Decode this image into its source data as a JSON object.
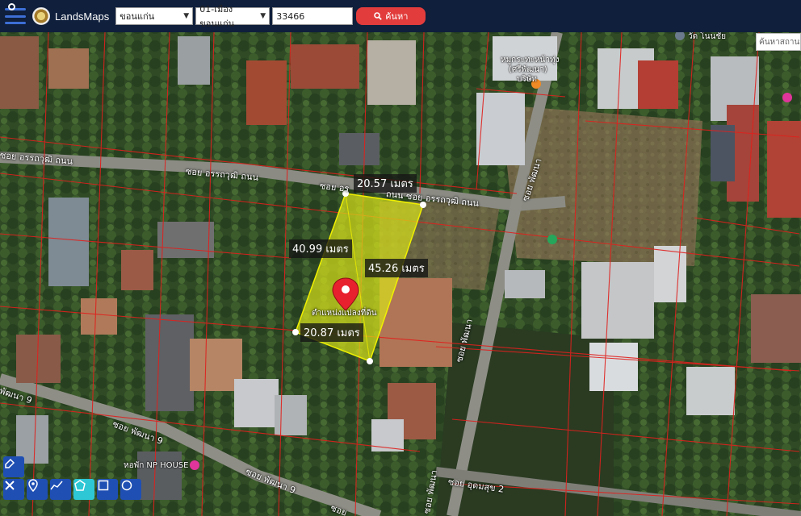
{
  "header": {
    "brand": "LandsMaps",
    "province_value": "ขอนแก่น",
    "district_value": "01-เมืองขอนแก่น",
    "parcel_number": "33466",
    "search_label": "ค้นหา"
  },
  "map": {
    "search_place_placeholder": "ค้นหาสถานที่",
    "measurements": {
      "top_edge": "20.57 เมตร",
      "left_edge": "40.99 เมตร",
      "right_edge": "45.26 เมตร",
      "bottom_edge": "20.87 เมตร"
    },
    "parcel_caption": "ตำแหน่งแปลงที่ดิน",
    "road_labels": [
      "ซอย อรรถวุฒิ ถนน",
      "ซอย อรรถวุฒิ ถนน",
      "ซอย อร",
      "ถนน ซอย อรรถวุฒิ ถนน",
      "ซอย พัฒนา",
      "ซอย พัฒนา",
      "ซอย พัฒนา",
      "พัฒนา 9",
      "ซอย พัฒนา 9",
      "ซอย พัฒนา 9",
      "ซอย อุดมสุข 2",
      "ซอย"
    ],
    "poi_labels": [
      "หมูกระทะหน้าทุ่ง",
      "(ศรีพัฒนา)",
      "บริษัท",
      "หอพัก NP HOUSE",
      "วัด โนนชัย"
    ],
    "colors": {
      "parcel_fill": "#d9e21a",
      "parcel_stroke": "#f0f000",
      "boundary_red": "#e0201d",
      "pin_red": "#e8212e",
      "topbar": "#0f1f3c",
      "search_button": "#e23c3c",
      "tool_blue": "#1f4fb3",
      "tool_active": "#2ec7d6"
    }
  },
  "toolbar": {
    "tools": [
      "eraser-icon",
      "close-cross-icon",
      "marker-icon",
      "line-measure-icon",
      "polygon-icon",
      "rectangle-icon",
      "circle-icon"
    ],
    "active_tool": "polygon-icon"
  }
}
